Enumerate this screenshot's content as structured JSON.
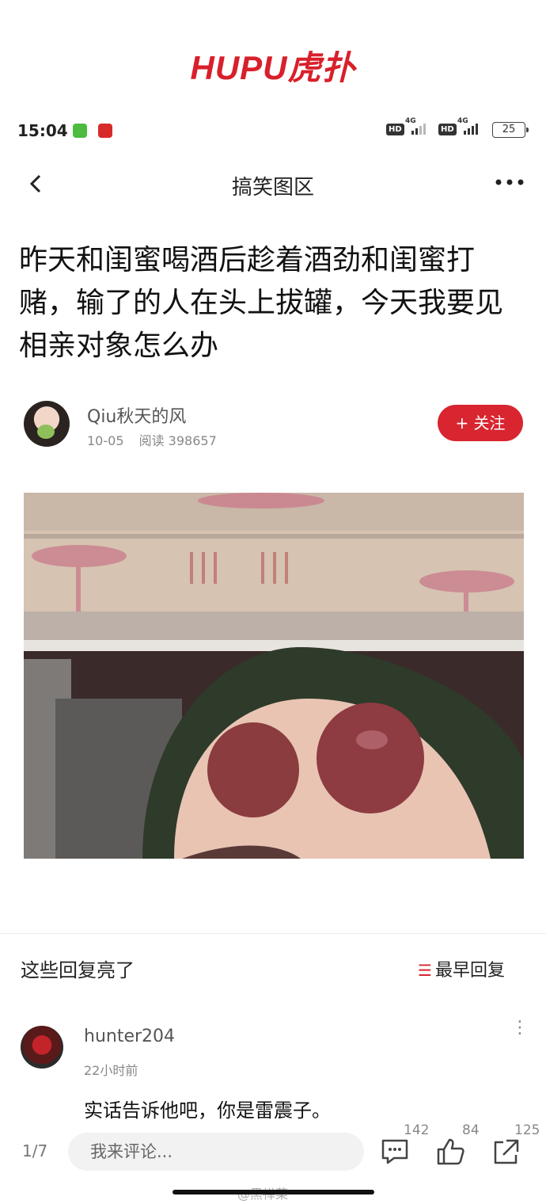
{
  "brand": "HUPU虎扑",
  "status_bar": {
    "time": "15:04",
    "net1": "4G",
    "net2": "4G",
    "hd": "HD",
    "battery": "25"
  },
  "nav": {
    "back_icon": "chevron-left-icon",
    "title": "搞笑图区",
    "more_icon": "more-dots-icon"
  },
  "post": {
    "title": "昨天和闺蜜喝酒后趁着酒劲和闺蜜打赌，输了的人在头上拔罐，今天我要见相亲对象怎么办",
    "author": "Qiu秋天的风",
    "date": "10-05",
    "views_label": "阅读 398657",
    "follow_label": "+ 关注"
  },
  "replies": {
    "section_title": "这些回复亮了",
    "sort_label": "最早回复",
    "items": [
      {
        "user": "hunter204",
        "time": "22小时前",
        "text": "实话告诉他吧，你是雷震子。"
      }
    ]
  },
  "bottom_bar": {
    "page": "1/7",
    "placeholder": "我来评论...",
    "comment_count": "142",
    "like_count": "84",
    "share_count": "125"
  },
  "watermark": "@黑禅菜",
  "colors": {
    "accent": "#d8252f"
  }
}
